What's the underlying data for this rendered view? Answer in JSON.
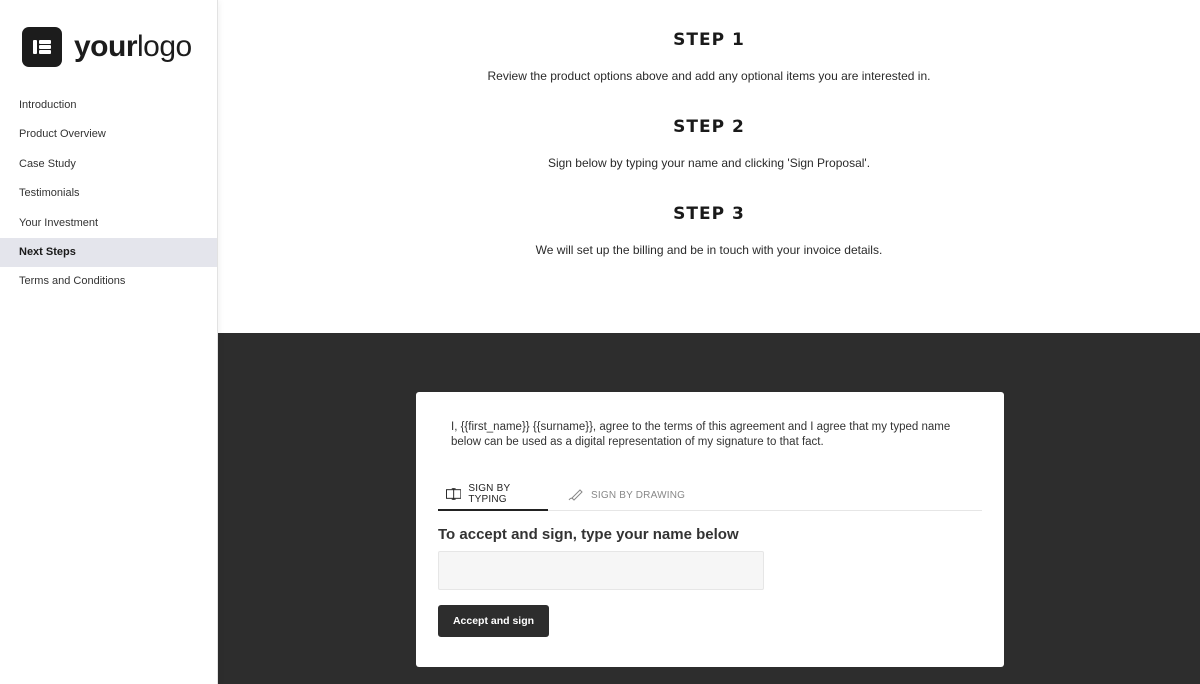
{
  "logo": {
    "bold_text": "your",
    "light_text": "logo"
  },
  "sidebar": {
    "items": [
      {
        "label": "Introduction"
      },
      {
        "label": "Product Overview"
      },
      {
        "label": "Case Study"
      },
      {
        "label": "Testimonials"
      },
      {
        "label": "Your Investment"
      },
      {
        "label": "Next Steps",
        "active": true
      },
      {
        "label": "Terms and Conditions"
      }
    ]
  },
  "steps": [
    {
      "title": "STEP 1",
      "description": "Review the product options above and add any optional items you are interested in."
    },
    {
      "title": "STEP 2",
      "description": "Sign below by typing your name and clicking 'Sign Proposal'."
    },
    {
      "title": "STEP 3",
      "description": "We will set up the billing and be in touch with your invoice details."
    }
  ],
  "signature": {
    "agreement_text": "I, {{first_name}} {{surname}}, agree to the terms of this agreement and I agree that my typed name below can be used as a digital representation of my signature to that fact.",
    "tabs": [
      {
        "label": "SIGN BY TYPING",
        "icon": "typing-icon",
        "active": true
      },
      {
        "label": "SIGN BY DRAWING",
        "icon": "pen-icon",
        "active": false
      }
    ],
    "heading": "To accept and sign, type your name below",
    "name_value": "",
    "name_placeholder": "",
    "button_label": "Accept and sign"
  },
  "colors": {
    "dark_background": "#2d2d2d",
    "active_nav_background": "#e4e5ec",
    "button_background": "#2d2d2d",
    "input_background": "#f6f6f6"
  }
}
